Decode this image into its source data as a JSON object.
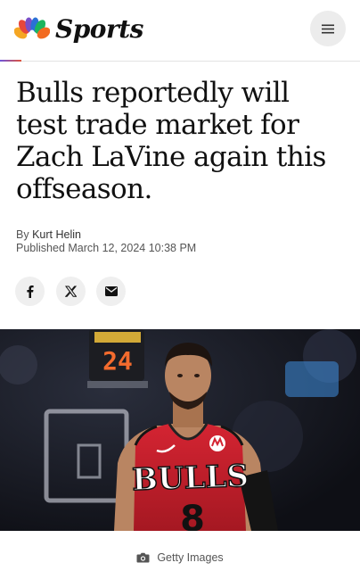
{
  "header": {
    "brand_word": "Sports",
    "menu_icon": "hamburger-menu-icon",
    "brand_colors": [
      "#f5a623",
      "#e8473b",
      "#7a4fc9",
      "#2a71d6",
      "#1bb55e",
      "#f26b21"
    ]
  },
  "article": {
    "headline": "Bulls reportedly will test trade market for Zach LaVine again this offseason.",
    "by_prefix": "By",
    "author": "Kurt Helin",
    "published": "Published March 12, 2024 10:38 PM",
    "share": [
      {
        "icon": "facebook-icon"
      },
      {
        "icon": "x-icon"
      },
      {
        "icon": "mail-icon"
      }
    ],
    "image": {
      "scoreboard_digits": "24",
      "jersey_text": "BULLS",
      "jersey_number": "8",
      "caption_icon": "camera-icon",
      "caption": "Getty Images"
    }
  },
  "colors": {
    "bulls_red": "#c9202f",
    "text": "#111111",
    "muted": "#555555"
  }
}
